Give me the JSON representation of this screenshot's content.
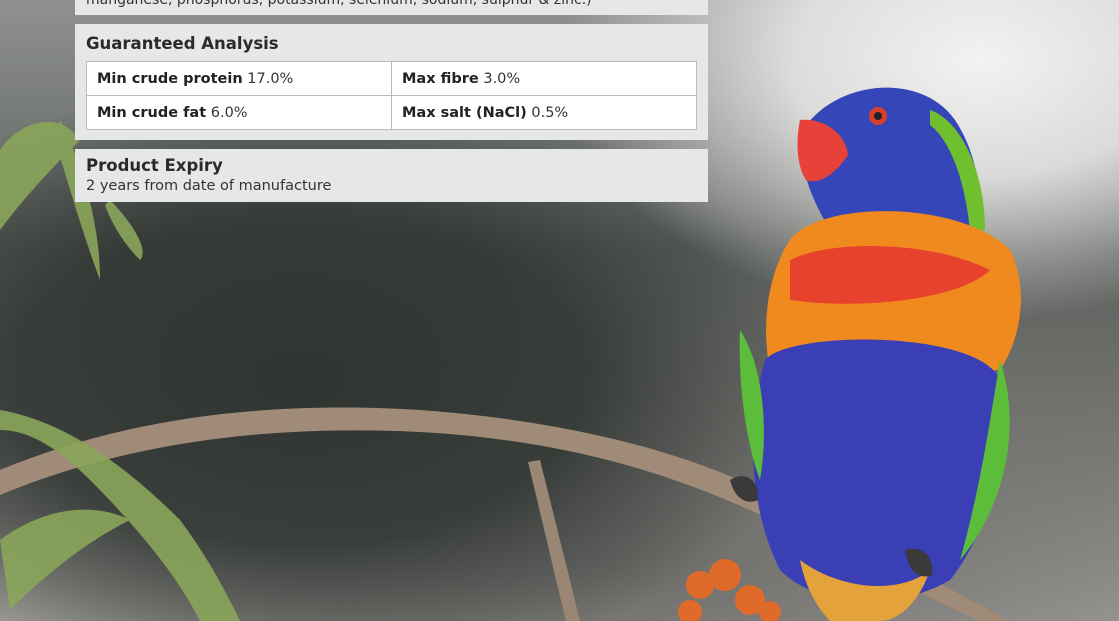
{
  "card": {
    "partial_text": "manganese, phosphorus, potassium, selenium, sodium, sulphur & zinc.)",
    "guaranteed_analysis": {
      "title": "Guaranteed Analysis",
      "rows": [
        [
          {
            "label": "Min crude protein",
            "value": "17.0%"
          },
          {
            "label": "Max fibre",
            "value": "3.0%"
          }
        ],
        [
          {
            "label": "Min crude fat",
            "value": "6.0%"
          },
          {
            "label": "Max salt (NaCl)",
            "value": "0.5%"
          }
        ]
      ]
    },
    "product_expiry": {
      "title": "Product Expiry",
      "text": "2 years from date of manufacture"
    }
  },
  "colors": {
    "panel_bg": "#e6e7e8",
    "table_border": "#b9bbbd"
  }
}
